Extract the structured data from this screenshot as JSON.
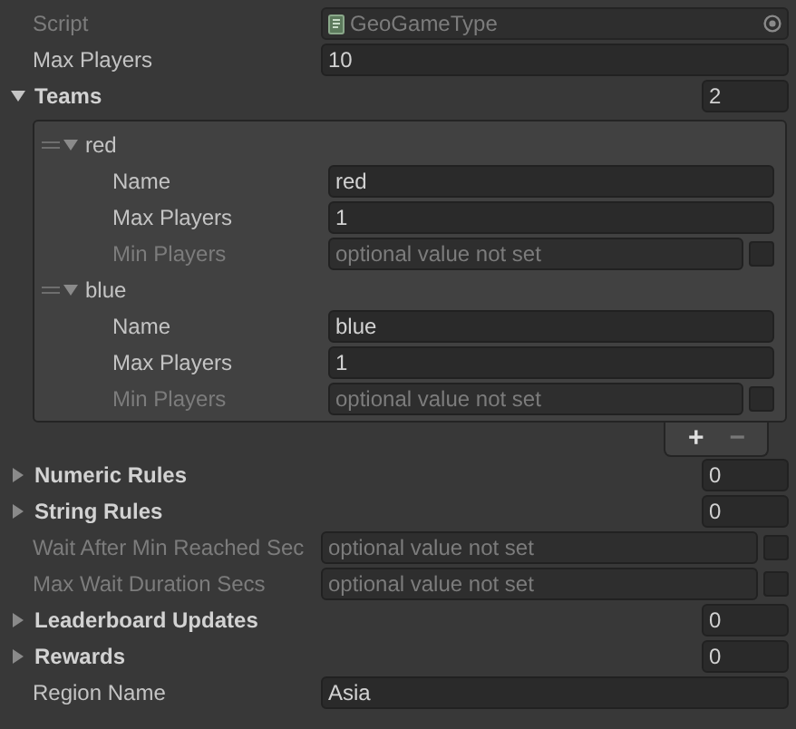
{
  "fields": [
    {
      "kind": "object",
      "label": "Script",
      "value": "GeoGameType",
      "disabled": true
    },
    {
      "kind": "text",
      "label": "Max Players",
      "value": "10"
    },
    {
      "kind": "list",
      "label": "Teams",
      "count": "2",
      "expanded": true,
      "elements": [
        {
          "label": "red",
          "expanded": true,
          "fields": [
            {
              "kind": "text",
              "label": "Name",
              "value": "red"
            },
            {
              "kind": "text",
              "label": "Max Players",
              "value": "1"
            },
            {
              "kind": "optional",
              "label": "Min Players",
              "placeholder": "optional value not set",
              "checked": false
            }
          ]
        },
        {
          "label": "blue",
          "expanded": true,
          "fields": [
            {
              "kind": "text",
              "label": "Name",
              "value": "blue"
            },
            {
              "kind": "text",
              "label": "Max Players",
              "value": "1"
            },
            {
              "kind": "optional",
              "label": "Min Players",
              "placeholder": "optional value not set",
              "checked": false
            }
          ]
        }
      ],
      "buttons": [
        {
          "label": "+",
          "disabled": false
        },
        {
          "label": "−",
          "disabled": true
        }
      ]
    },
    {
      "kind": "list",
      "label": "Numeric Rules",
      "count": "0",
      "expanded": false
    },
    {
      "kind": "list",
      "label": "String Rules",
      "count": "0",
      "expanded": false
    },
    {
      "kind": "optional",
      "label": "Wait After Min Reached Sec",
      "placeholder": "optional value not set",
      "checked": false
    },
    {
      "kind": "optional",
      "label": "Max Wait Duration Secs",
      "placeholder": "optional value not set",
      "checked": false
    },
    {
      "kind": "list",
      "label": "Leaderboard Updates",
      "count": "0",
      "expanded": false
    },
    {
      "kind": "list",
      "label": "Rewards",
      "count": "0",
      "expanded": false
    },
    {
      "kind": "text",
      "label": "Region Name",
      "value": "Asia"
    }
  ]
}
